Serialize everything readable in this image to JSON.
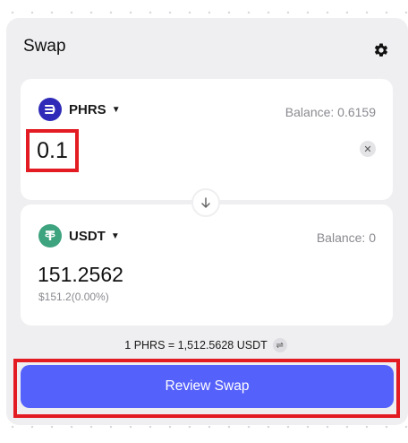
{
  "header": {
    "title": "Swap",
    "settings_icon": "gear-icon"
  },
  "from": {
    "token": "PHRS",
    "icon": "phrs-logo-icon",
    "balance": "Balance: 0.6159",
    "amount": "0.1",
    "clear_label": "✕"
  },
  "switch_icon": "arrow-down-icon",
  "to": {
    "token": "USDT",
    "icon": "usdt-logo-icon",
    "balance": "Balance: 0",
    "amount": "151.2562",
    "usd_value": "$151.2(0.00%)"
  },
  "rate": {
    "text": "1 PHRS = 1,512.5628 USDT",
    "toggle_label": "⇌"
  },
  "review_button": "Review Swap",
  "colors": {
    "accent": "#5561fb",
    "highlight": "#e31b23",
    "usdt": "#3ea37f",
    "phrs": "#2f2bb8"
  }
}
